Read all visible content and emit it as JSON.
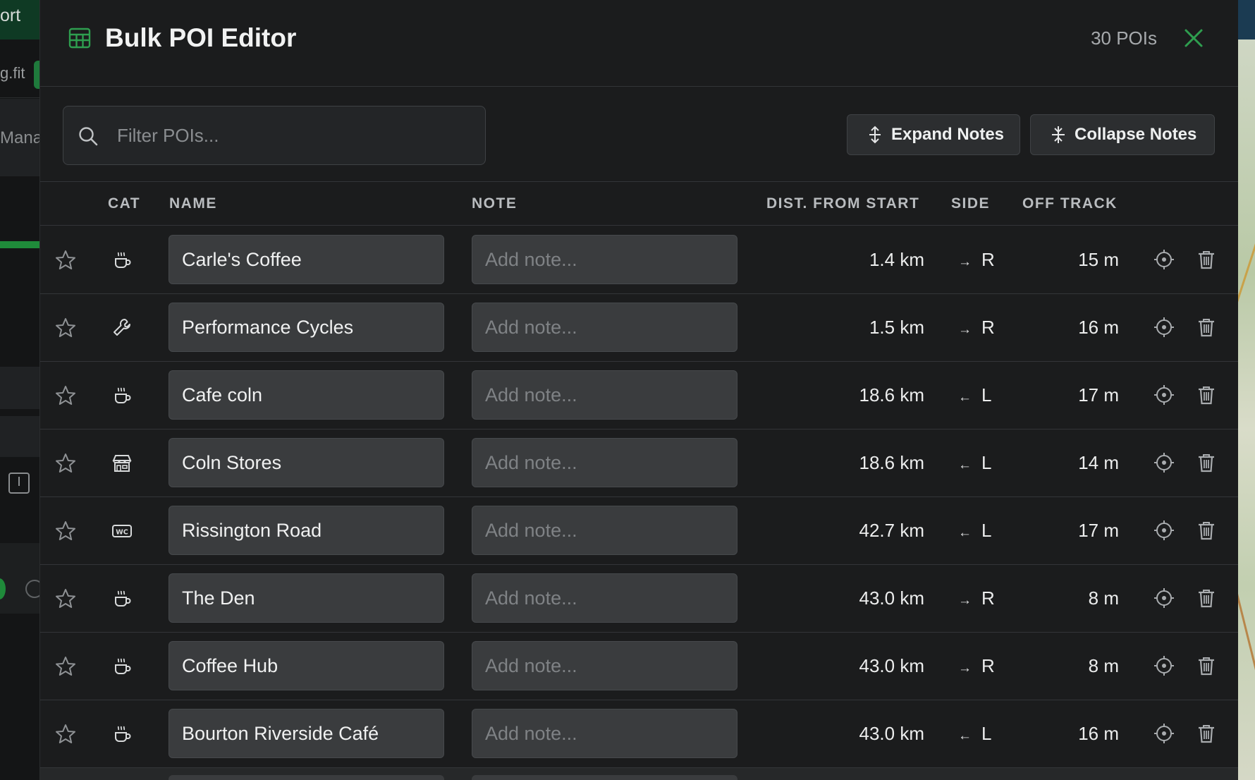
{
  "background": {
    "top_label": "ort",
    "file_label": "g.fit",
    "manage_label": "Manag"
  },
  "modal": {
    "title": "Bulk POI Editor",
    "count": "30 POIs",
    "search_placeholder": "Filter POIs...",
    "expand_label": "Expand Notes",
    "collapse_label": "Collapse Notes",
    "accent": "#2e9e4f"
  },
  "columns": {
    "cat": "CAT",
    "name": "NAME",
    "note": "NOTE",
    "dist": "DIST. FROM START",
    "side": "SIDE",
    "off": "OFF TRACK"
  },
  "note_placeholder": "Add note...",
  "rows": [
    {
      "icon": "coffee-icon",
      "name": "Carle's Coffee",
      "dist": "1.4 km",
      "arrow": "→",
      "side": "R",
      "off": "15 m"
    },
    {
      "icon": "wrench-icon",
      "name": "Performance Cycles",
      "dist": "1.5 km",
      "arrow": "→",
      "side": "R",
      "off": "16 m"
    },
    {
      "icon": "coffee-icon",
      "name": "Cafe coln",
      "dist": "18.6 km",
      "arrow": "←",
      "side": "L",
      "off": "17 m"
    },
    {
      "icon": "store-icon",
      "name": "Coln Stores",
      "dist": "18.6 km",
      "arrow": "←",
      "side": "L",
      "off": "14 m"
    },
    {
      "icon": "wc-icon",
      "name": "Rissington Road",
      "dist": "42.7 km",
      "arrow": "←",
      "side": "L",
      "off": "17 m"
    },
    {
      "icon": "coffee-icon",
      "name": "The Den",
      "dist": "43.0 km",
      "arrow": "→",
      "side": "R",
      "off": "8 m"
    },
    {
      "icon": "coffee-icon",
      "name": "Coffee Hub",
      "dist": "43.0 km",
      "arrow": "→",
      "side": "R",
      "off": "8 m"
    },
    {
      "icon": "coffee-icon",
      "name": "Bourton Riverside Café",
      "dist": "43.0 km",
      "arrow": "←",
      "side": "L",
      "off": "16 m"
    }
  ]
}
